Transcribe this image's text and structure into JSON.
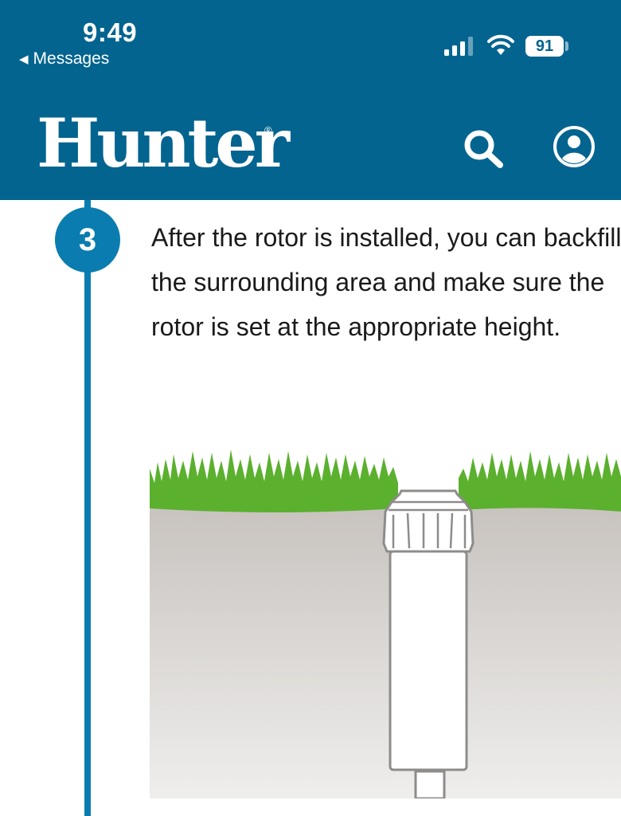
{
  "status_bar": {
    "time": "9:49",
    "back_label": "Messages",
    "battery": "91"
  },
  "header": {
    "logo_text": "Hunter",
    "logo_mark": "®",
    "search_icon": "search-icon",
    "account_icon": "account-icon",
    "background_color": "#03648f"
  },
  "step": {
    "number": "3",
    "text": "After the rotor is installed, you can backfill the surrounding area and make sure the rotor is set at the appropriate height."
  },
  "colors": {
    "accent": "#0a7cb0",
    "grass": "#5bb02e",
    "soil": "#c9c4c0"
  }
}
